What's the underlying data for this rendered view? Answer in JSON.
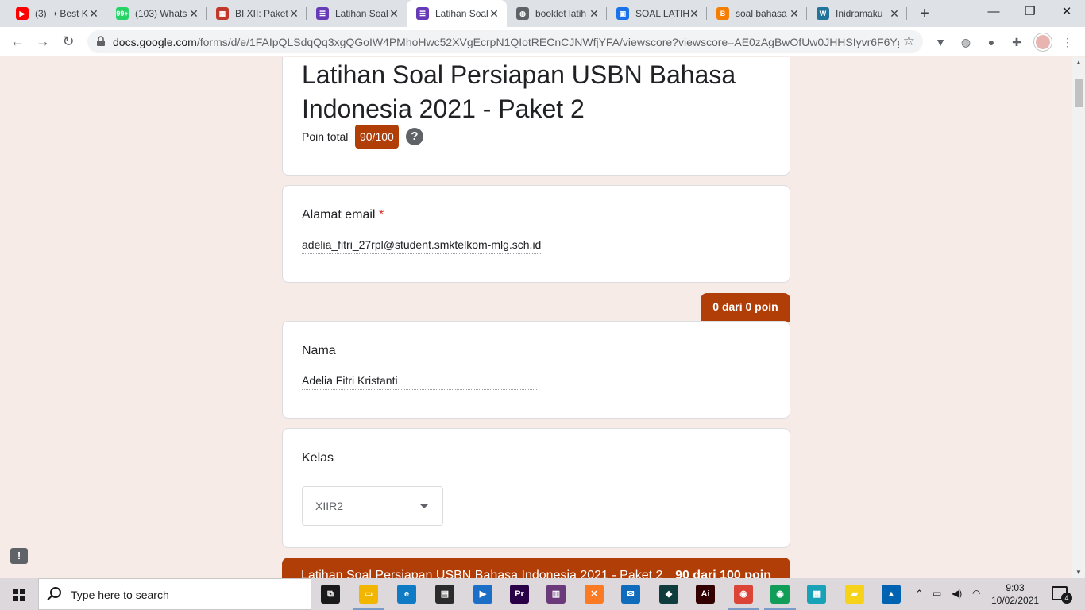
{
  "tabs": [
    {
      "title": "(3) ➝ Best K",
      "icon": "youtube-icon",
      "color": "#ff0000",
      "glyph": "▶"
    },
    {
      "title": "(103) Whats",
      "icon": "whatsapp-icon",
      "color": "#25d366",
      "glyph": "99+"
    },
    {
      "title": "BI XII: Paket",
      "icon": "doc-icon",
      "color": "#c0392b",
      "glyph": "▦"
    },
    {
      "title": "Latihan Soal",
      "icon": "google-forms-icon",
      "color": "#673ab7",
      "glyph": "☰"
    },
    {
      "title": "Latihan Soal",
      "icon": "google-forms-icon",
      "color": "#673ab7",
      "glyph": "☰"
    },
    {
      "title": "booklet latih",
      "icon": "globe-icon",
      "color": "#5f6368",
      "glyph": "◍"
    },
    {
      "title": "SOAL LATIH",
      "icon": "classroom-icon",
      "color": "#1a73e8",
      "glyph": "▣"
    },
    {
      "title": "soal bahasa",
      "icon": "blogger-icon",
      "color": "#f57d00",
      "glyph": "B"
    },
    {
      "title": "Inidramaku",
      "icon": "wordpress-icon",
      "color": "#21759b",
      "glyph": "W"
    }
  ],
  "browser": {
    "url_host": "docs.google.com",
    "url_path": "/forms/d/e/1FAIpQLSdqQq3xgQGoIW4PMhoHwc52XVgEcrpN1QIotRECnCJNWfjYFA/viewscore?viewscore=AE0zAgBwOfUw0JHHSIyvr6F6YgL..."
  },
  "form": {
    "title": "Latihan Soal Persiapan USBN Bahasa Indonesia 2021 - Paket 2",
    "total_label": "Poin total",
    "total_score": "90/100",
    "help_glyph": "?",
    "email_label": "Alamat email",
    "required_mark": "*",
    "email_value": "adelia_fitri_27rpl@student.smktelkom-mlg.sch.id",
    "points_tab": "0 dari 0 poin",
    "name_label": "Nama",
    "name_value": "Adelia Fitri Kristanti",
    "class_label": "Kelas",
    "class_value": "XIIR2",
    "footer_title": "Latihan Soal Persiapan USBN Bahasa Indonesia 2021 - Paket 2",
    "footer_score": "90 dari 100 poin",
    "accent_color": "#b23e07"
  },
  "taskbar": {
    "search_placeholder": "Type here to search",
    "time": "9:03",
    "date": "10/02/2021",
    "notification_count": "4",
    "apps": [
      {
        "name": "task-view-icon",
        "color": "#1a1a1a",
        "glyph": "⧉"
      },
      {
        "name": "file-explorer-icon",
        "color": "#f2b600",
        "glyph": "▭"
      },
      {
        "name": "edge-icon",
        "color": "#0f7bc4",
        "glyph": "e"
      },
      {
        "name": "store-icon",
        "color": "#2b2b2b",
        "glyph": "▤"
      },
      {
        "name": "video-editor-icon",
        "color": "#1b6fc7",
        "glyph": "▶"
      },
      {
        "name": "premiere-icon",
        "color": "#2a0046",
        "glyph": "Pr"
      },
      {
        "name": "winrar-icon",
        "color": "#6b3a7a",
        "glyph": "▥"
      },
      {
        "name": "xampp-icon",
        "color": "#fb7a24",
        "glyph": "✕"
      },
      {
        "name": "mail-icon",
        "color": "#0f6cbd",
        "glyph": "✉"
      },
      {
        "name": "filmora-icon",
        "color": "#0f3d3e",
        "glyph": "◆"
      },
      {
        "name": "illustrator-icon",
        "color": "#330000",
        "glyph": "Ai"
      },
      {
        "name": "chrome-icon",
        "color": "#db4437",
        "glyph": "◉"
      },
      {
        "name": "chrome-profile-icon",
        "color": "#0f9d58",
        "glyph": "◉"
      },
      {
        "name": "unknown-app-icon",
        "color": "#17a2b8",
        "glyph": "▦"
      },
      {
        "name": "sticky-notes-icon",
        "color": "#f7d21b",
        "glyph": "▰"
      },
      {
        "name": "photos-icon",
        "color": "#0063b1",
        "glyph": "▲"
      }
    ]
  }
}
